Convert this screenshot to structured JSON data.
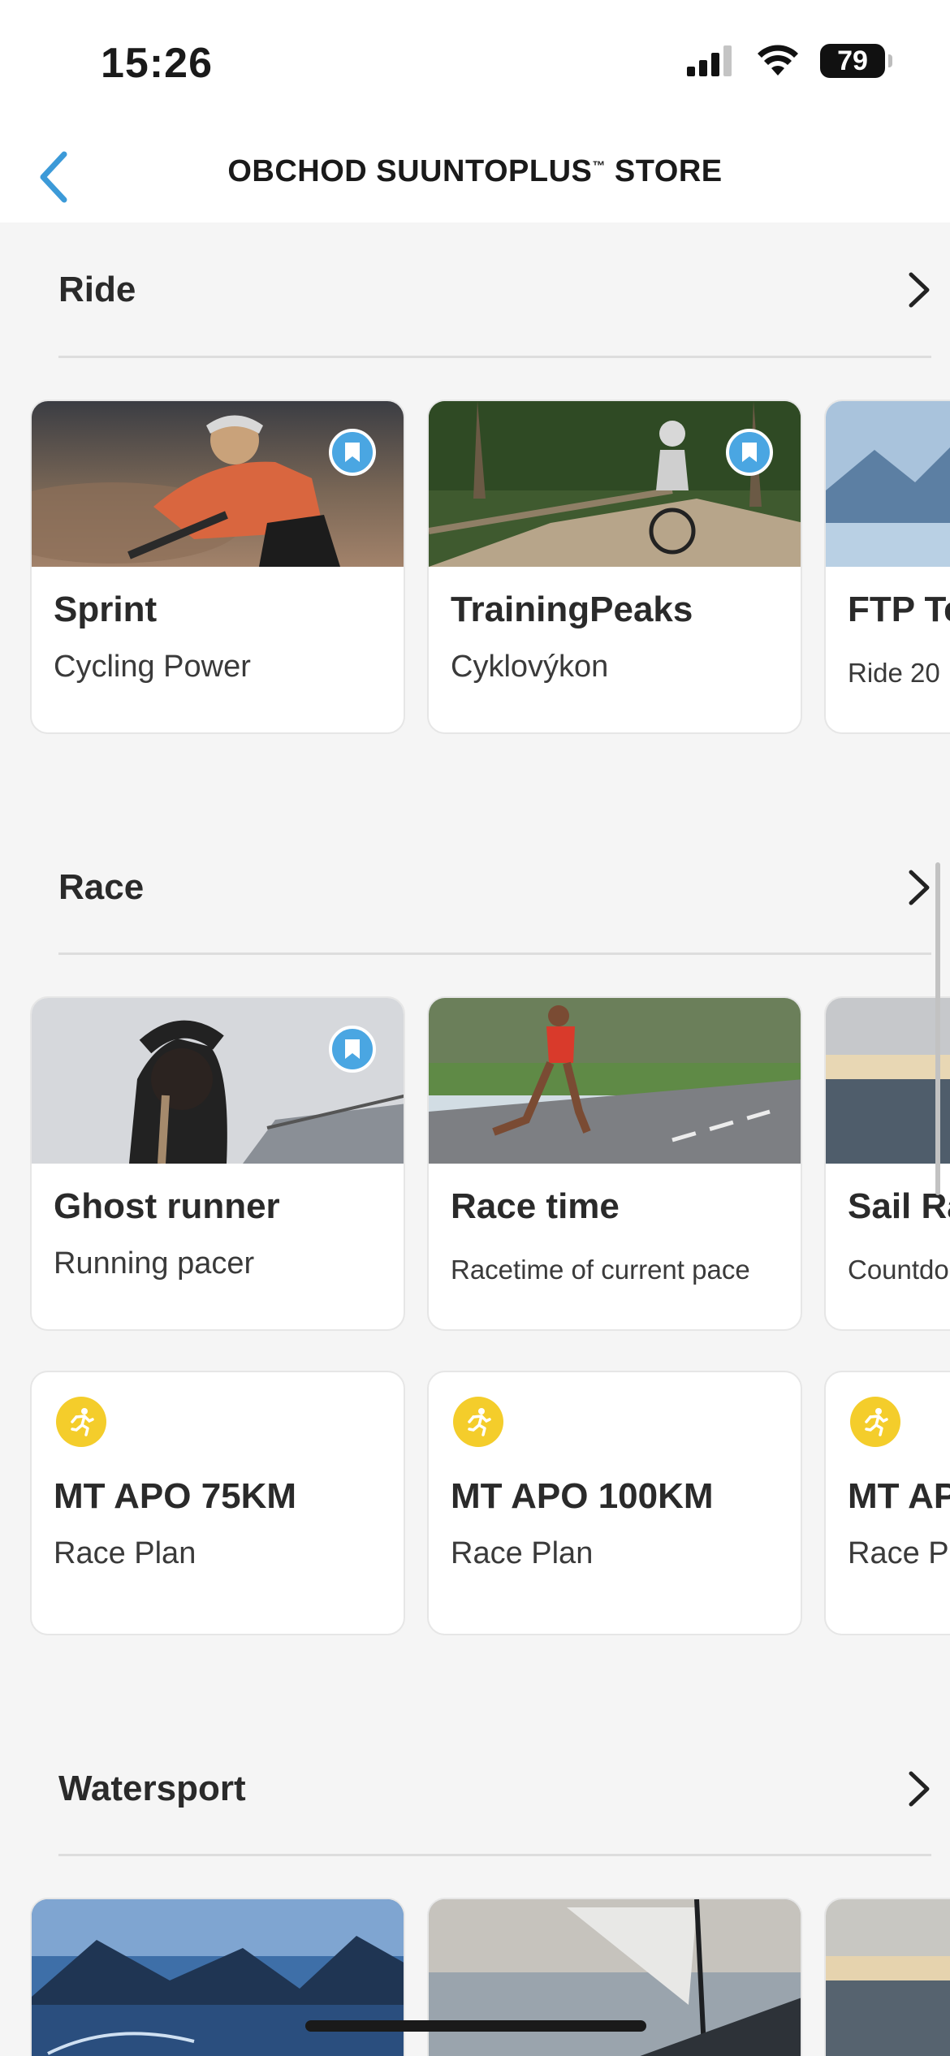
{
  "status_bar": {
    "time": "15:26",
    "battery": "79"
  },
  "nav": {
    "title": "OBCHOD SUUNTOPLUS",
    "trademark": "™",
    "title_suffix": " STORE"
  },
  "sections": [
    {
      "title": "Ride",
      "cards": [
        {
          "title": "Sprint",
          "subtitle": "Cycling Power",
          "bookmarked": true
        },
        {
          "title": "TrainingPeaks",
          "subtitle": "Cyklovýkon",
          "bookmarked": true
        },
        {
          "title": "FTP Te",
          "subtitle": "Ride 20"
        }
      ]
    },
    {
      "title": "Race",
      "cards": [
        {
          "title": "Ghost runner",
          "subtitle": "Running pacer",
          "bookmarked": true
        },
        {
          "title": "Race time",
          "subtitle": "Racetime of current pace"
        },
        {
          "title": "Sail Ra",
          "subtitle": "Countdo"
        }
      ],
      "plan_cards": [
        {
          "title": "MT APO 75KM",
          "subtitle": "Race Plan"
        },
        {
          "title": "MT APO 100KM",
          "subtitle": "Race Plan"
        },
        {
          "title": "MT AP",
          "subtitle": "Race P"
        }
      ]
    },
    {
      "title": "Watersport"
    }
  ],
  "colors": {
    "accent": "#4aa6e2",
    "race_icon": "#f4cd2b",
    "background": "#f5f5f5"
  }
}
